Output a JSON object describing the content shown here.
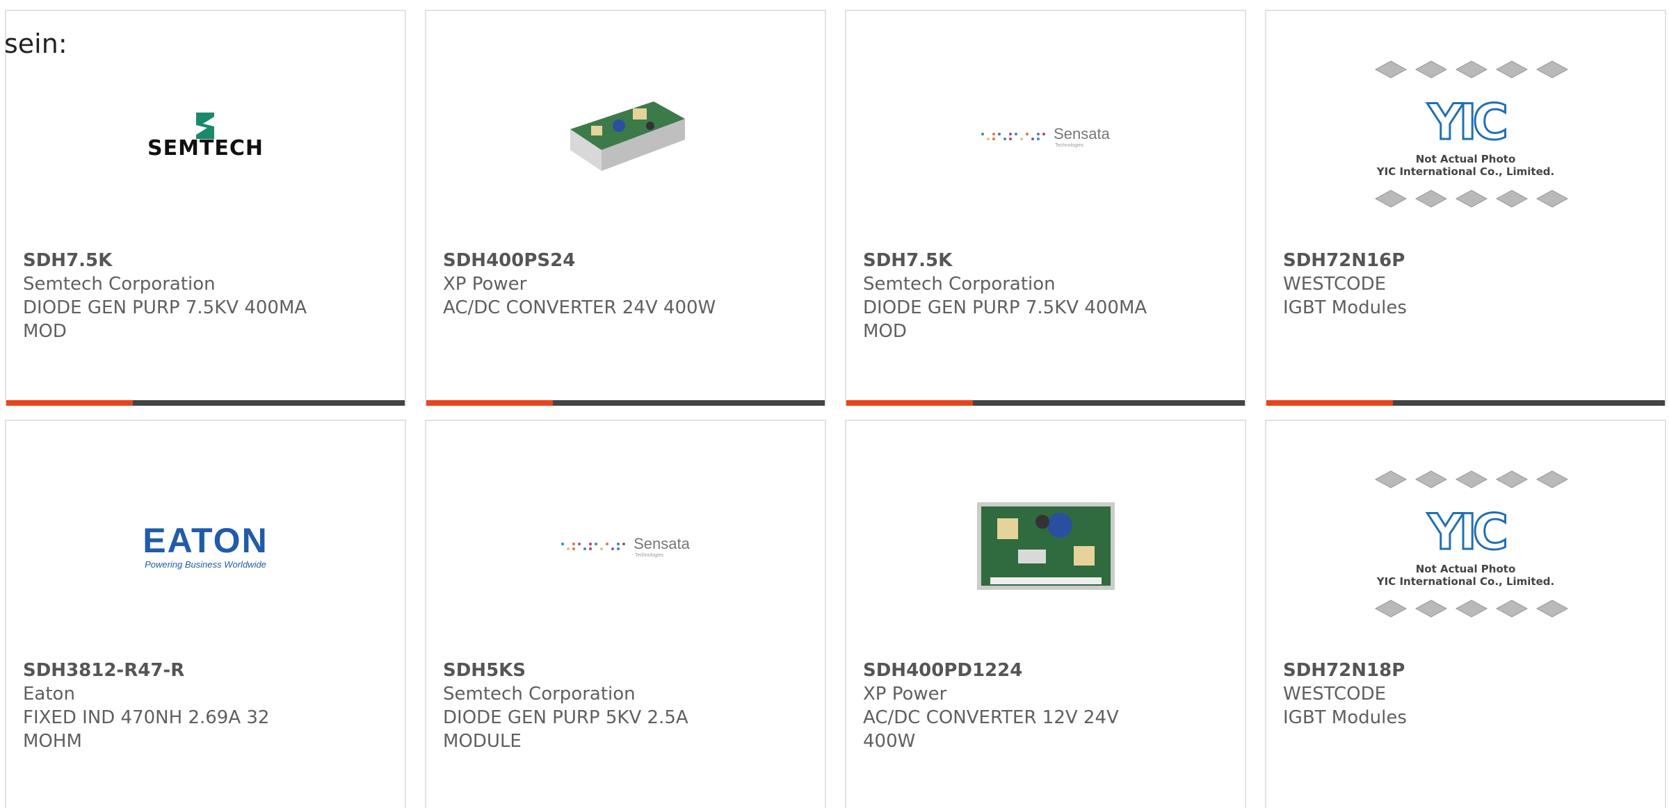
{
  "intro_text": "sein:",
  "colors": {
    "accent": "#e8441c",
    "bar": "#444444",
    "border": "#e2e2e2"
  },
  "logos": {
    "semtech": "SEMTECH",
    "sensata": {
      "name": "Sensata",
      "sub": "Technologies"
    },
    "eaton": {
      "name": "EATON",
      "tag": "Powering Business Worldwide"
    },
    "yic": {
      "line1": "Not Actual Photo",
      "line2": "YIC International Co., Limited."
    }
  },
  "products": [
    {
      "part": "SDH7.5K",
      "manufacturer": "Semtech Corporation",
      "description": "DIODE GEN PURP 7.5KV 400MA MOD",
      "image": "semtech-logo",
      "accent_bar": true
    },
    {
      "part": "SDH400PS24",
      "manufacturer": "XP Power",
      "description": "AC/DC CONVERTER 24V 400W",
      "image": "power-supply-photo-angled",
      "accent_bar": true
    },
    {
      "part": "SDH7.5K",
      "manufacturer": "Semtech Corporation",
      "description": "DIODE GEN PURP 7.5KV 400MA MOD",
      "image": "sensata-logo",
      "accent_bar": true
    },
    {
      "part": "SDH72N16P",
      "manufacturer": "WESTCODE",
      "description": "IGBT Modules",
      "image": "yic-placeholder",
      "accent_bar": true
    },
    {
      "part": "SDH3812-R47-R",
      "manufacturer": "Eaton",
      "description": "FIXED IND 470NH 2.69A 32 MOHM",
      "image": "eaton-logo",
      "accent_bar": false
    },
    {
      "part": "SDH5KS",
      "manufacturer": "Semtech Corporation",
      "description": "DIODE GEN PURP 5KV 2.5A MODULE",
      "image": "sensata-logo",
      "accent_bar": false
    },
    {
      "part": "SDH400PD1224",
      "manufacturer": "XP Power",
      "description": "AC/DC CONVERTER 12V 24V 400W",
      "image": "power-supply-photo-top",
      "accent_bar": false
    },
    {
      "part": "SDH72N18P",
      "manufacturer": "WESTCODE",
      "description": "IGBT Modules",
      "image": "yic-placeholder",
      "accent_bar": false
    }
  ]
}
